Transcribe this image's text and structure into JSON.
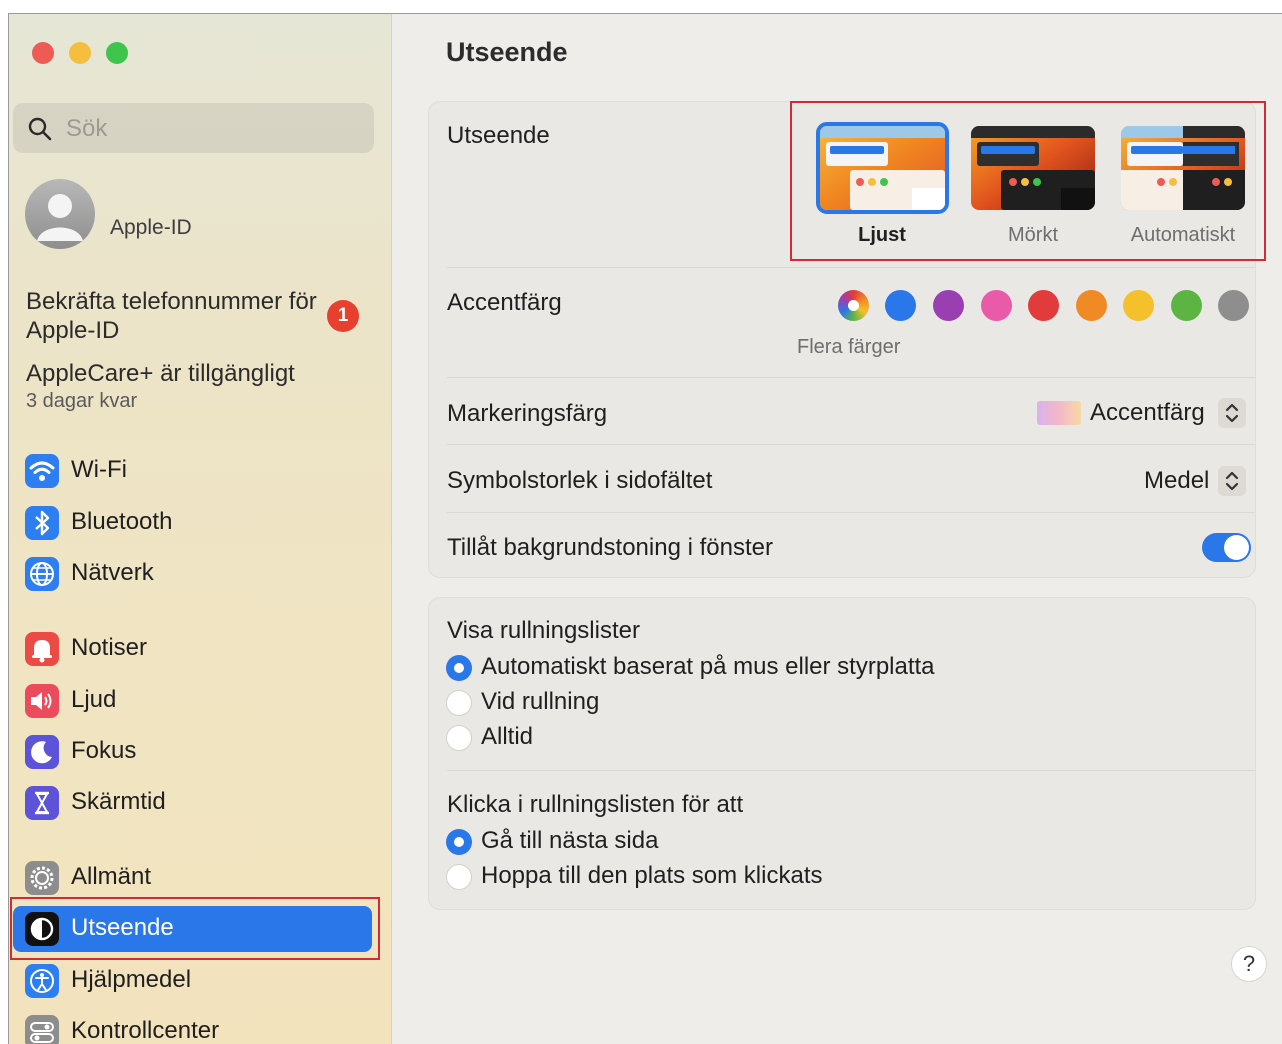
{
  "window": {
    "traffic_lights": [
      {
        "name": "close",
        "color": "#ee5b54"
      },
      {
        "name": "minimize",
        "color": "#f5be3e"
      },
      {
        "name": "zoom",
        "color": "#3ec54b"
      }
    ]
  },
  "sidebar": {
    "search_placeholder": "Sök",
    "account_label": "Apple-ID",
    "notice_phone": "Bekräfta telefonnummer för Apple-ID",
    "notice_badge": "1",
    "notice_applecare": "AppleCare+ är tillgängligt",
    "notice_applecare_sub": "3 dagar kvar",
    "items": [
      {
        "label": "Wi-Fi",
        "icon": "wifi-icon",
        "color": "#2d7ef0"
      },
      {
        "label": "Bluetooth",
        "icon": "bluetooth-icon",
        "color": "#2d7ef0"
      },
      {
        "label": "Nätverk",
        "icon": "globe-icon",
        "color": "#2d7ef0"
      },
      {
        "label": "Notiser",
        "icon": "bell-icon",
        "color": "#ec4a45"
      },
      {
        "label": "Ljud",
        "icon": "speaker-icon",
        "color": "#ec4a5d"
      },
      {
        "label": "Fokus",
        "icon": "moon-icon",
        "color": "#5c53d9"
      },
      {
        "label": "Skärmtid",
        "icon": "hourglass-icon",
        "color": "#5c53d9"
      },
      {
        "label": "Allmänt",
        "icon": "gear-icon",
        "color": "#8d8d8d"
      },
      {
        "label": "Utseende",
        "icon": "appearance-icon",
        "color": "#111111",
        "active": true
      },
      {
        "label": "Hjälpmedel",
        "icon": "accessibility-icon",
        "color": "#2d7ef0"
      },
      {
        "label": "Kontrollcenter",
        "icon": "control-center-icon",
        "color": "#8d8d8d"
      }
    ]
  },
  "main": {
    "title": "Utseende",
    "appearance": {
      "label": "Utseende",
      "options": [
        {
          "label": "Ljust",
          "selected": true
        },
        {
          "label": "Mörkt",
          "selected": false
        },
        {
          "label": "Automatiskt",
          "selected": false
        }
      ]
    },
    "accent": {
      "label": "Accentfärg",
      "caption": "Flera färger",
      "colors": [
        "multicolor",
        "#2a77ea",
        "#9a3fb1",
        "#e95ba9",
        "#e23b3b",
        "#f08a25",
        "#f4c12c",
        "#5cb543",
        "#8e8e8e"
      ]
    },
    "highlight": {
      "label": "Markeringsfärg",
      "value": "Accentfärg"
    },
    "sidebar_icon_size": {
      "label": "Symbolstorlek i sidofältet",
      "value": "Medel"
    },
    "wallpaper_tinting": {
      "label": "Tillåt bakgrundstoning i fönster",
      "enabled": true
    },
    "scrollbars": {
      "label": "Visa rullningslister",
      "options": [
        {
          "label": "Automatiskt baserat på mus eller styrplatta",
          "selected": true
        },
        {
          "label": "Vid rullning",
          "selected": false
        },
        {
          "label": "Alltid",
          "selected": false
        }
      ]
    },
    "click_scrollbar": {
      "label": "Klicka i rullningslisten för att",
      "options": [
        {
          "label": "Gå till nästa sida",
          "selected": true
        },
        {
          "label": "Hoppa till den plats som klickats",
          "selected": false
        }
      ]
    },
    "help_button": "?"
  }
}
